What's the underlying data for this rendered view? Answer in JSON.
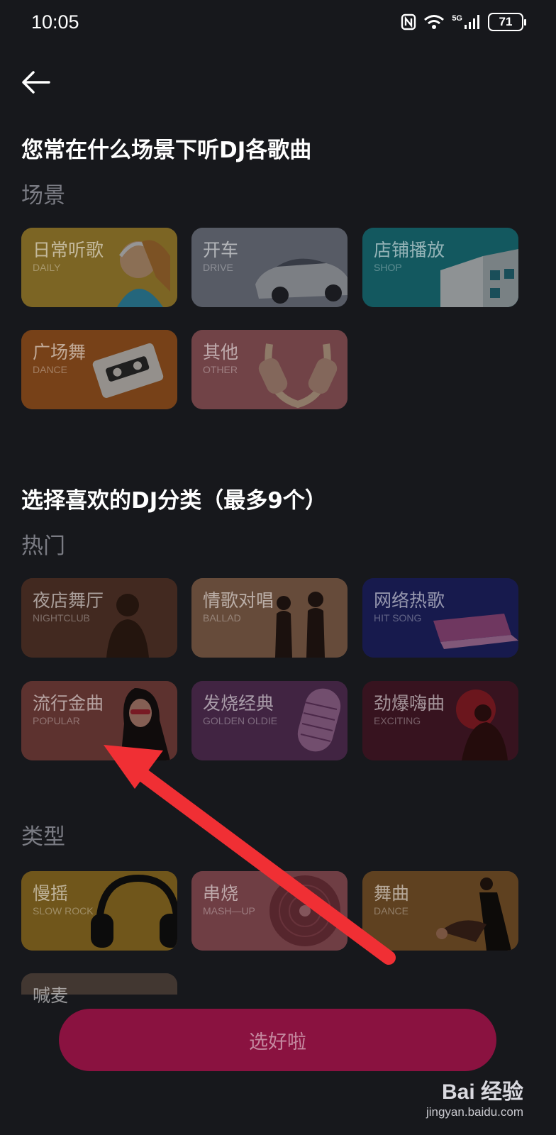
{
  "status_bar": {
    "time": "10:05",
    "network": "5G",
    "battery": "71",
    "icons": [
      "nfc-icon",
      "wifi-icon",
      "signal-icon",
      "battery-icon"
    ]
  },
  "header": {
    "back_icon": "arrow-left-icon"
  },
  "scene_section": {
    "title": "您常在什么场景下听DJ各歌曲",
    "subtitle": "场景",
    "cards": [
      {
        "label": "日常听歌",
        "sub": "DAILY",
        "color": "#c9a43a"
      },
      {
        "label": "开车",
        "sub": "DRIVE",
        "color": "#8d93a4"
      },
      {
        "label": "店铺播放",
        "sub": "SHOP",
        "color": "#1f8f99"
      },
      {
        "label": "广场舞",
        "sub": "DANCE",
        "color": "#c06a28"
      },
      {
        "label": "其他",
        "sub": "OTHER",
        "color": "#b76c73"
      }
    ]
  },
  "category_section": {
    "title": "选择喜欢的DJ分类（最多9个）",
    "hot_subtitle": "热门",
    "hot_cards": [
      {
        "label": "夜店舞厅",
        "sub": "NIGHTCLUB",
        "color": "#6b4334"
      },
      {
        "label": "情歌对唱",
        "sub": "BALLAD",
        "color": "#a57a5e"
      },
      {
        "label": "网络热歌",
        "sub": "HIT SONG",
        "color": "#262b7c"
      },
      {
        "label": "流行金曲",
        "sub": "POPULAR",
        "color": "#96524c"
      },
      {
        "label": "发烧经典",
        "sub": "GOLDEN OLDIE",
        "color": "#6a3a6b"
      },
      {
        "label": "劲爆嗨曲",
        "sub": "EXCITING",
        "color": "#5a1f32"
      }
    ],
    "type_subtitle": "类型",
    "type_cards": [
      {
        "label": "慢摇",
        "sub": "SLOW ROCK",
        "color": "#b58b2c"
      },
      {
        "label": "串烧",
        "sub": "MASH—UP",
        "color": "#b4646e"
      },
      {
        "label": "舞曲",
        "sub": "DANCE",
        "color": "#9a6a34"
      },
      {
        "label": "喊麦",
        "sub": "",
        "color": "#6b5a50"
      }
    ]
  },
  "confirm_button": "选好啦",
  "watermark": {
    "brand": "Bai 经验",
    "url": "jingyan.baidu.com"
  }
}
